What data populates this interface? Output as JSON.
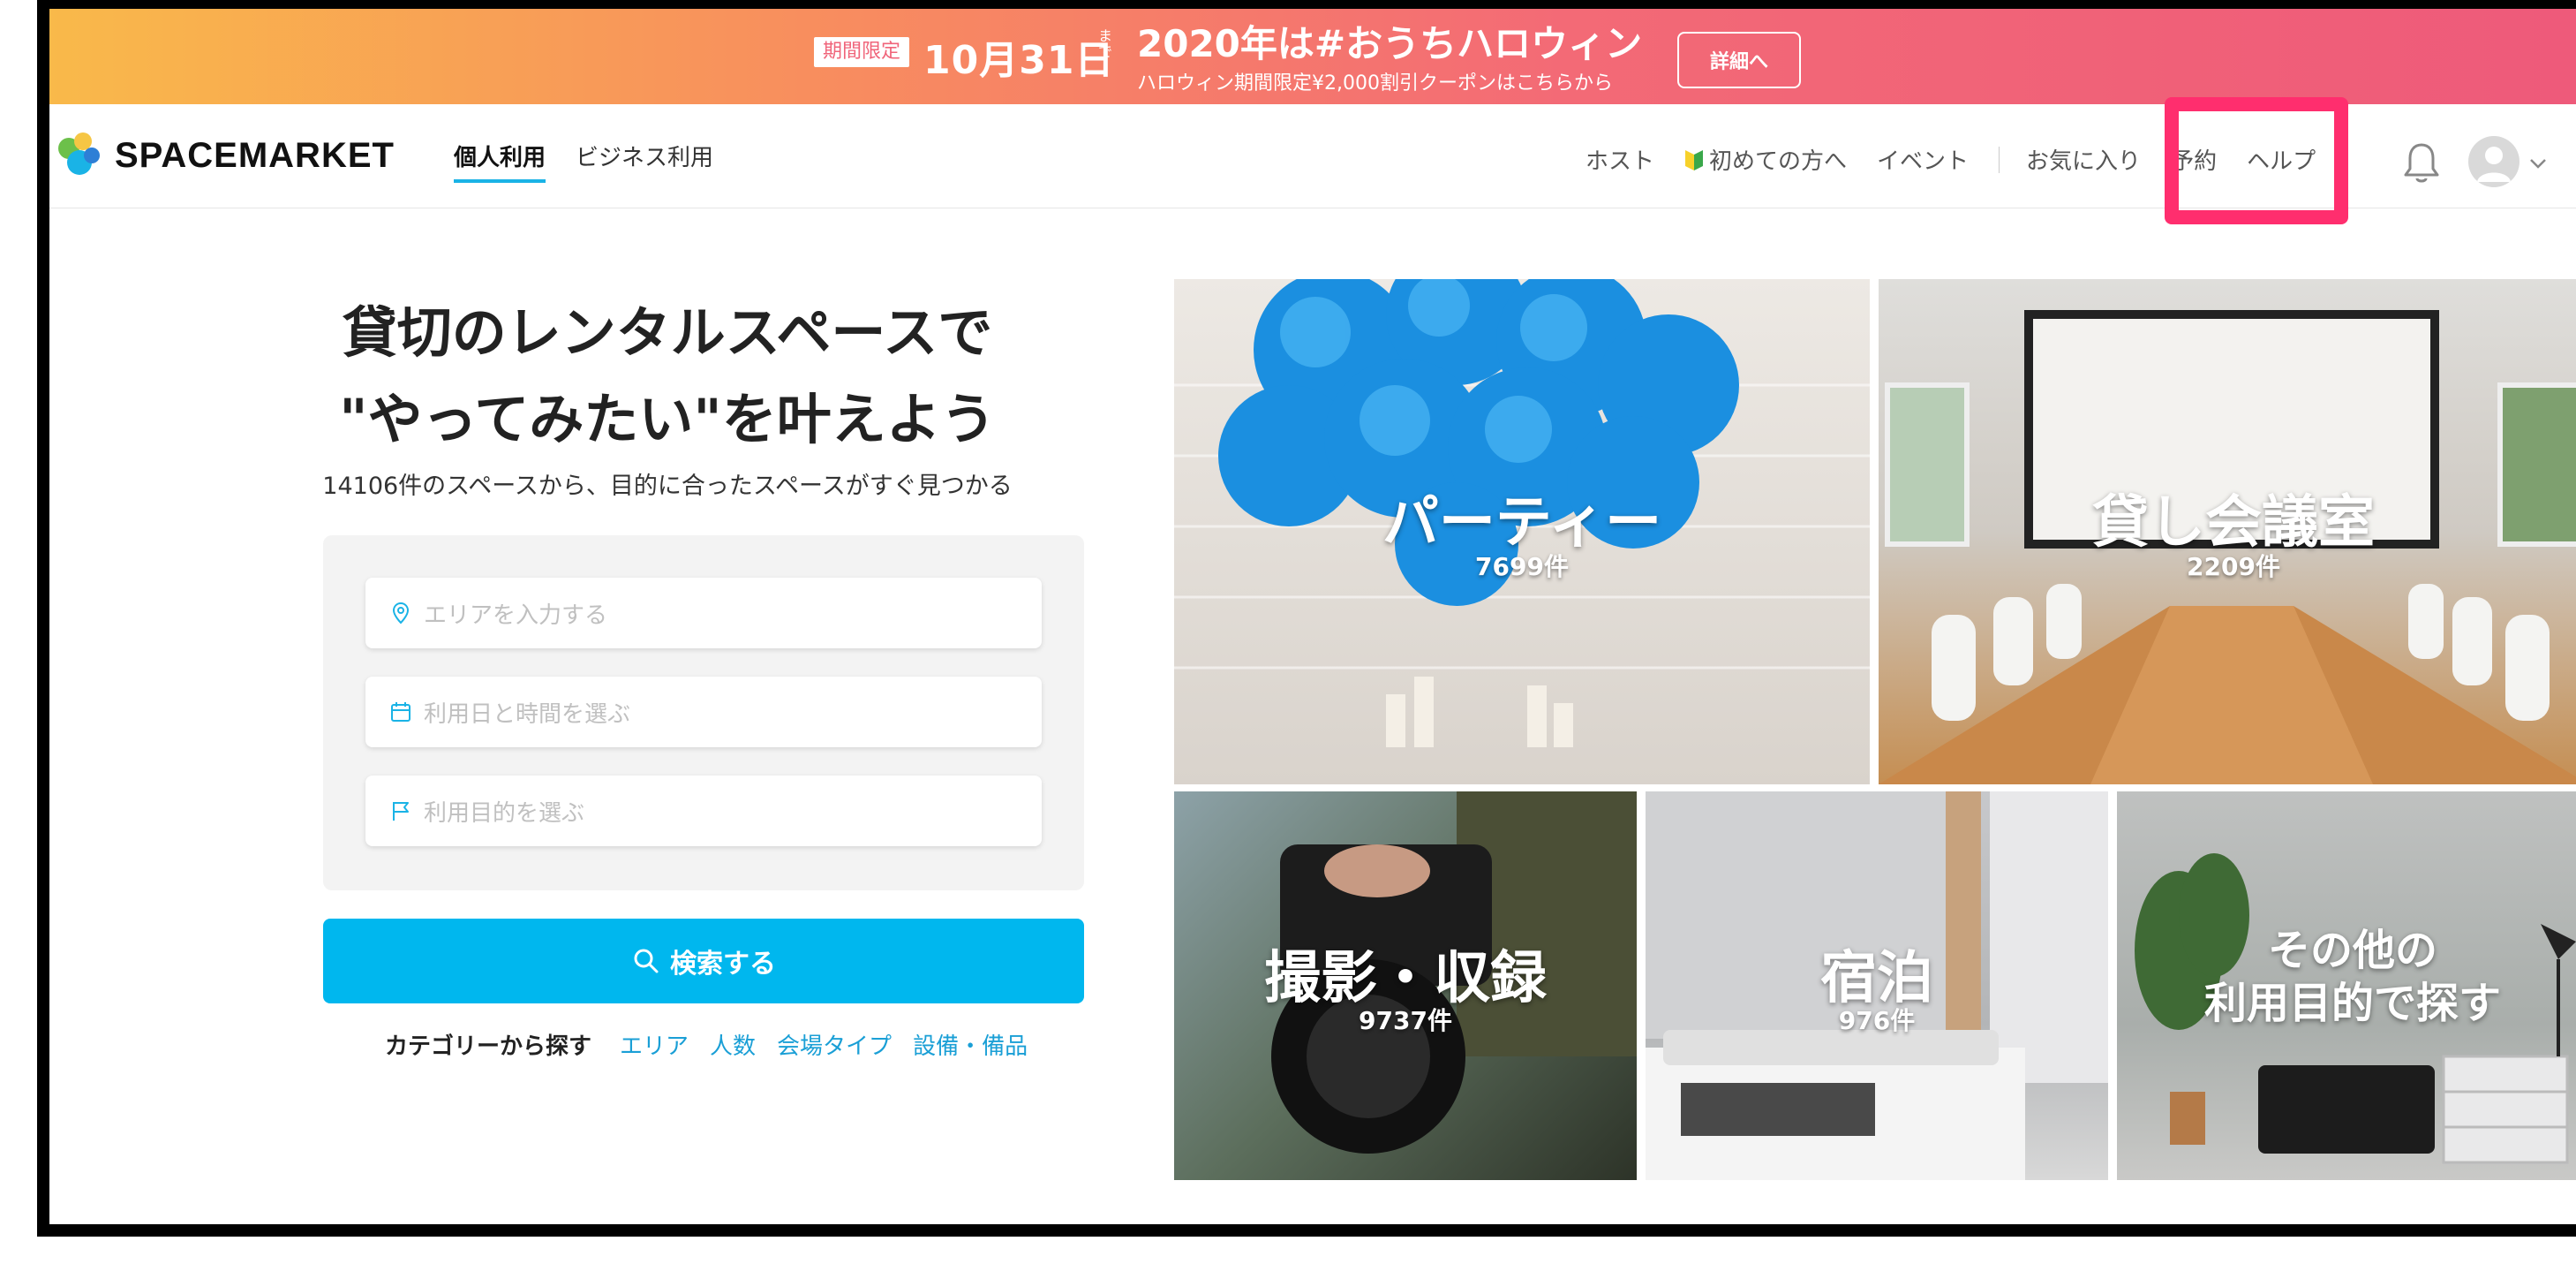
{
  "banner": {
    "tag": "期間限定",
    "date": "10月31日",
    "made": "まで",
    "headline": "2020年は#おうちハロウィン",
    "sub": "ハロウィン期間限定¥2,000割引クーポンはこちらから",
    "detail_label": "詳細へ"
  },
  "nav": {
    "logo": "SPACEMARKET",
    "tabs": [
      {
        "label": "個人利用",
        "active": true
      },
      {
        "label": "ビジネス利用",
        "active": false
      }
    ],
    "links": {
      "host": "ホスト",
      "beginner": "初めての方へ",
      "event": "イベント",
      "favorites": "お気に入り",
      "reservations": "予約",
      "help": "ヘルプ"
    },
    "icons": [
      "beginner-mark-icon",
      "bell-icon",
      "user-avatar-icon",
      "chevron-down-icon"
    ]
  },
  "hero": {
    "title_line1": "貸切のレンタルスペースで",
    "title_line2": "\"やってみたい\"を叶えよう",
    "subtitle": "14106件のスペースから、目的に合ったスペースがすぐ見つかる"
  },
  "search": {
    "area_placeholder": "エリアを入力する",
    "date_placeholder": "利用日と時間を選ぶ",
    "purpose_placeholder": "利用目的を選ぶ",
    "button_label": "検索する"
  },
  "categories": {
    "label": "カテゴリーから探す",
    "links": [
      "エリア",
      "人数",
      "会場タイプ",
      "設備・備品"
    ]
  },
  "tiles": {
    "party": {
      "title": "パーティー",
      "count": "7699件"
    },
    "meeting": {
      "title": "貸し会議室",
      "count": "2209件"
    },
    "photo": {
      "title": "撮影・収録",
      "count": "9737件"
    },
    "stay": {
      "title": "宿泊",
      "count": "976件"
    },
    "other": {
      "title_line1": "その他の",
      "title_line2": "利用目的で探す"
    }
  },
  "colors": {
    "accent": "#00b7ee",
    "link": "#1a9fd6",
    "highlight": "#ff2e6e",
    "banner_start": "#f9b94a",
    "banner_end": "#ee5a7a"
  }
}
